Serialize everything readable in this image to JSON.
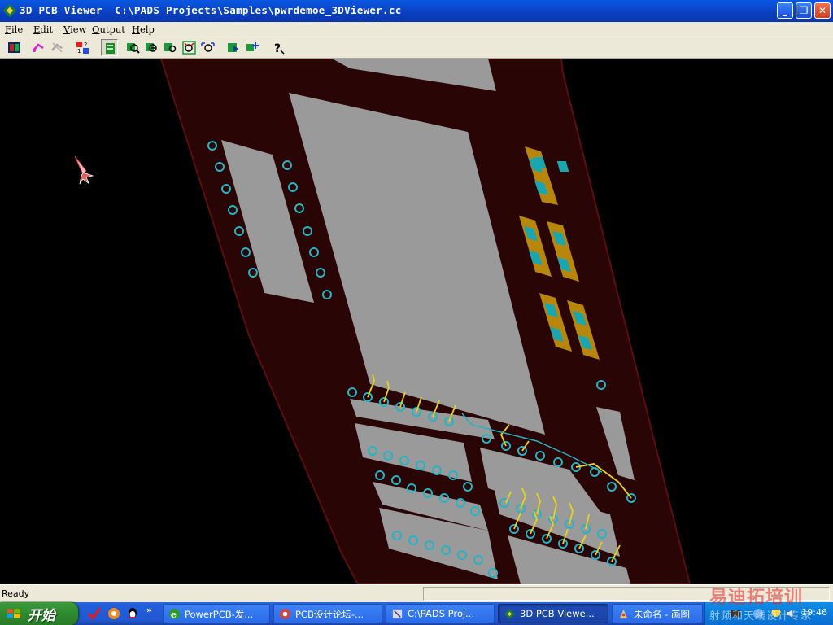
{
  "window": {
    "title": "3D PCB Viewer  C:\\PADS Projects\\Samples\\pwrdemoe_3DViewer.cc",
    "buttons": {
      "minimize": "_",
      "maximize": "❐",
      "close": "✕"
    }
  },
  "menu": {
    "items": [
      {
        "label": "ile",
        "mnemonic": "F"
      },
      {
        "label": "dit",
        "mnemonic": "E"
      },
      {
        "label": "iew",
        "mnemonic": "V"
      },
      {
        "label": "utput",
        "mnemonic": "O"
      },
      {
        "label": "elp",
        "mnemonic": "H"
      }
    ]
  },
  "toolbar": {
    "icons": [
      "board-view-icon",
      "route-icon",
      "disabled-route-icon",
      "layer-numbers-icon",
      "layer-stack-icon",
      "zoom-in-icon",
      "zoom-out-icon",
      "zoom-window-icon",
      "zoom-extents-icon",
      "pan-icon",
      "rotate-icon",
      "fit-icon",
      "help-icon"
    ]
  },
  "status": {
    "text": "Ready"
  },
  "taskbar": {
    "start_label": "开始",
    "tasks": [
      {
        "label": "PowerPCB-发...",
        "icon": "ie-icon"
      },
      {
        "label": "PCB设计论坛-...",
        "icon": "pcb-forum-icon"
      },
      {
        "label": "C:\\PADS Proj...",
        "icon": "folder-icon"
      },
      {
        "label": "3D PCB Viewe...",
        "icon": "pcb-viewer-icon",
        "active": true
      },
      {
        "label": "未命名 - 画图",
        "icon": "paint-icon"
      }
    ],
    "clock": "19:46"
  },
  "watermark": {
    "main": "易迪拓培训",
    "sub": "射频和天线设计专家"
  },
  "colors": {
    "board": "#2a0505",
    "board_edge": "#5a0e0e",
    "copper_fill": "#9a9a9a",
    "via_ring": "#27b3c4",
    "trace": "#e8d21a",
    "pad_gold": "#b8860b",
    "pad_teal": "#1aa6b0"
  }
}
